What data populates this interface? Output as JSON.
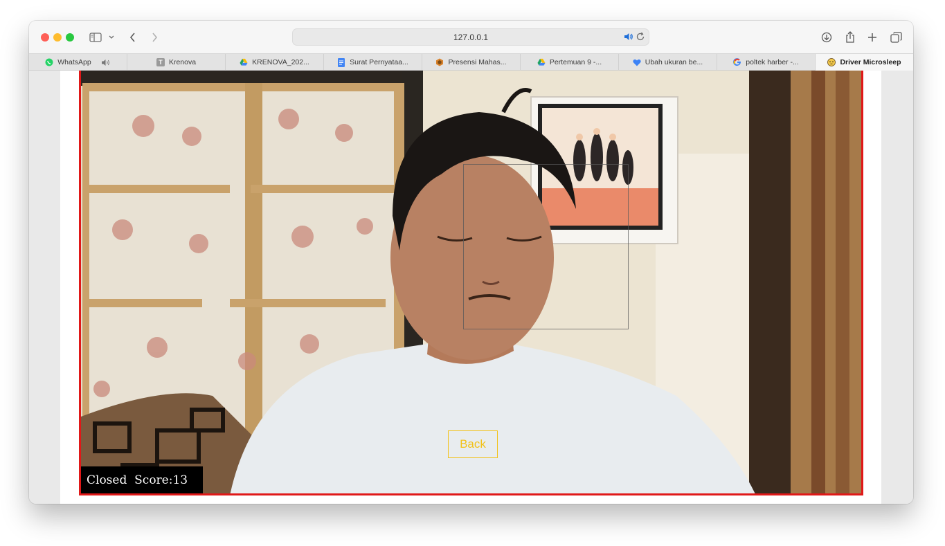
{
  "browser": {
    "url": "127.0.0.1",
    "tabs": [
      {
        "label": "WhatsApp",
        "icon": "whatsapp-icon",
        "playing_audio": true
      },
      {
        "label": "Krenova",
        "icon": "site-letter-icon"
      },
      {
        "label": "KRENOVA_202...",
        "icon": "google-drive-icon"
      },
      {
        "label": "Surat Pernyataa...",
        "icon": "google-docs-icon"
      },
      {
        "label": "Presensi Mahas...",
        "icon": "hexagon-icon"
      },
      {
        "label": "Pertemuan 9 -...",
        "icon": "google-drive-icon"
      },
      {
        "label": "Ubah ukuran be...",
        "icon": "heart-icon"
      },
      {
        "label": "poltek harber -...",
        "icon": "google-icon"
      },
      {
        "label": "Driver Microsleep",
        "icon": "sleep-face-icon",
        "active": true
      }
    ],
    "favicon_letter": "T"
  },
  "page": {
    "back_label": "Back",
    "status": "Closed  Score:13"
  },
  "colors": {
    "video_border": "#e01818",
    "back_accent": "#f2c21a",
    "overlay_bg": "#000000"
  }
}
